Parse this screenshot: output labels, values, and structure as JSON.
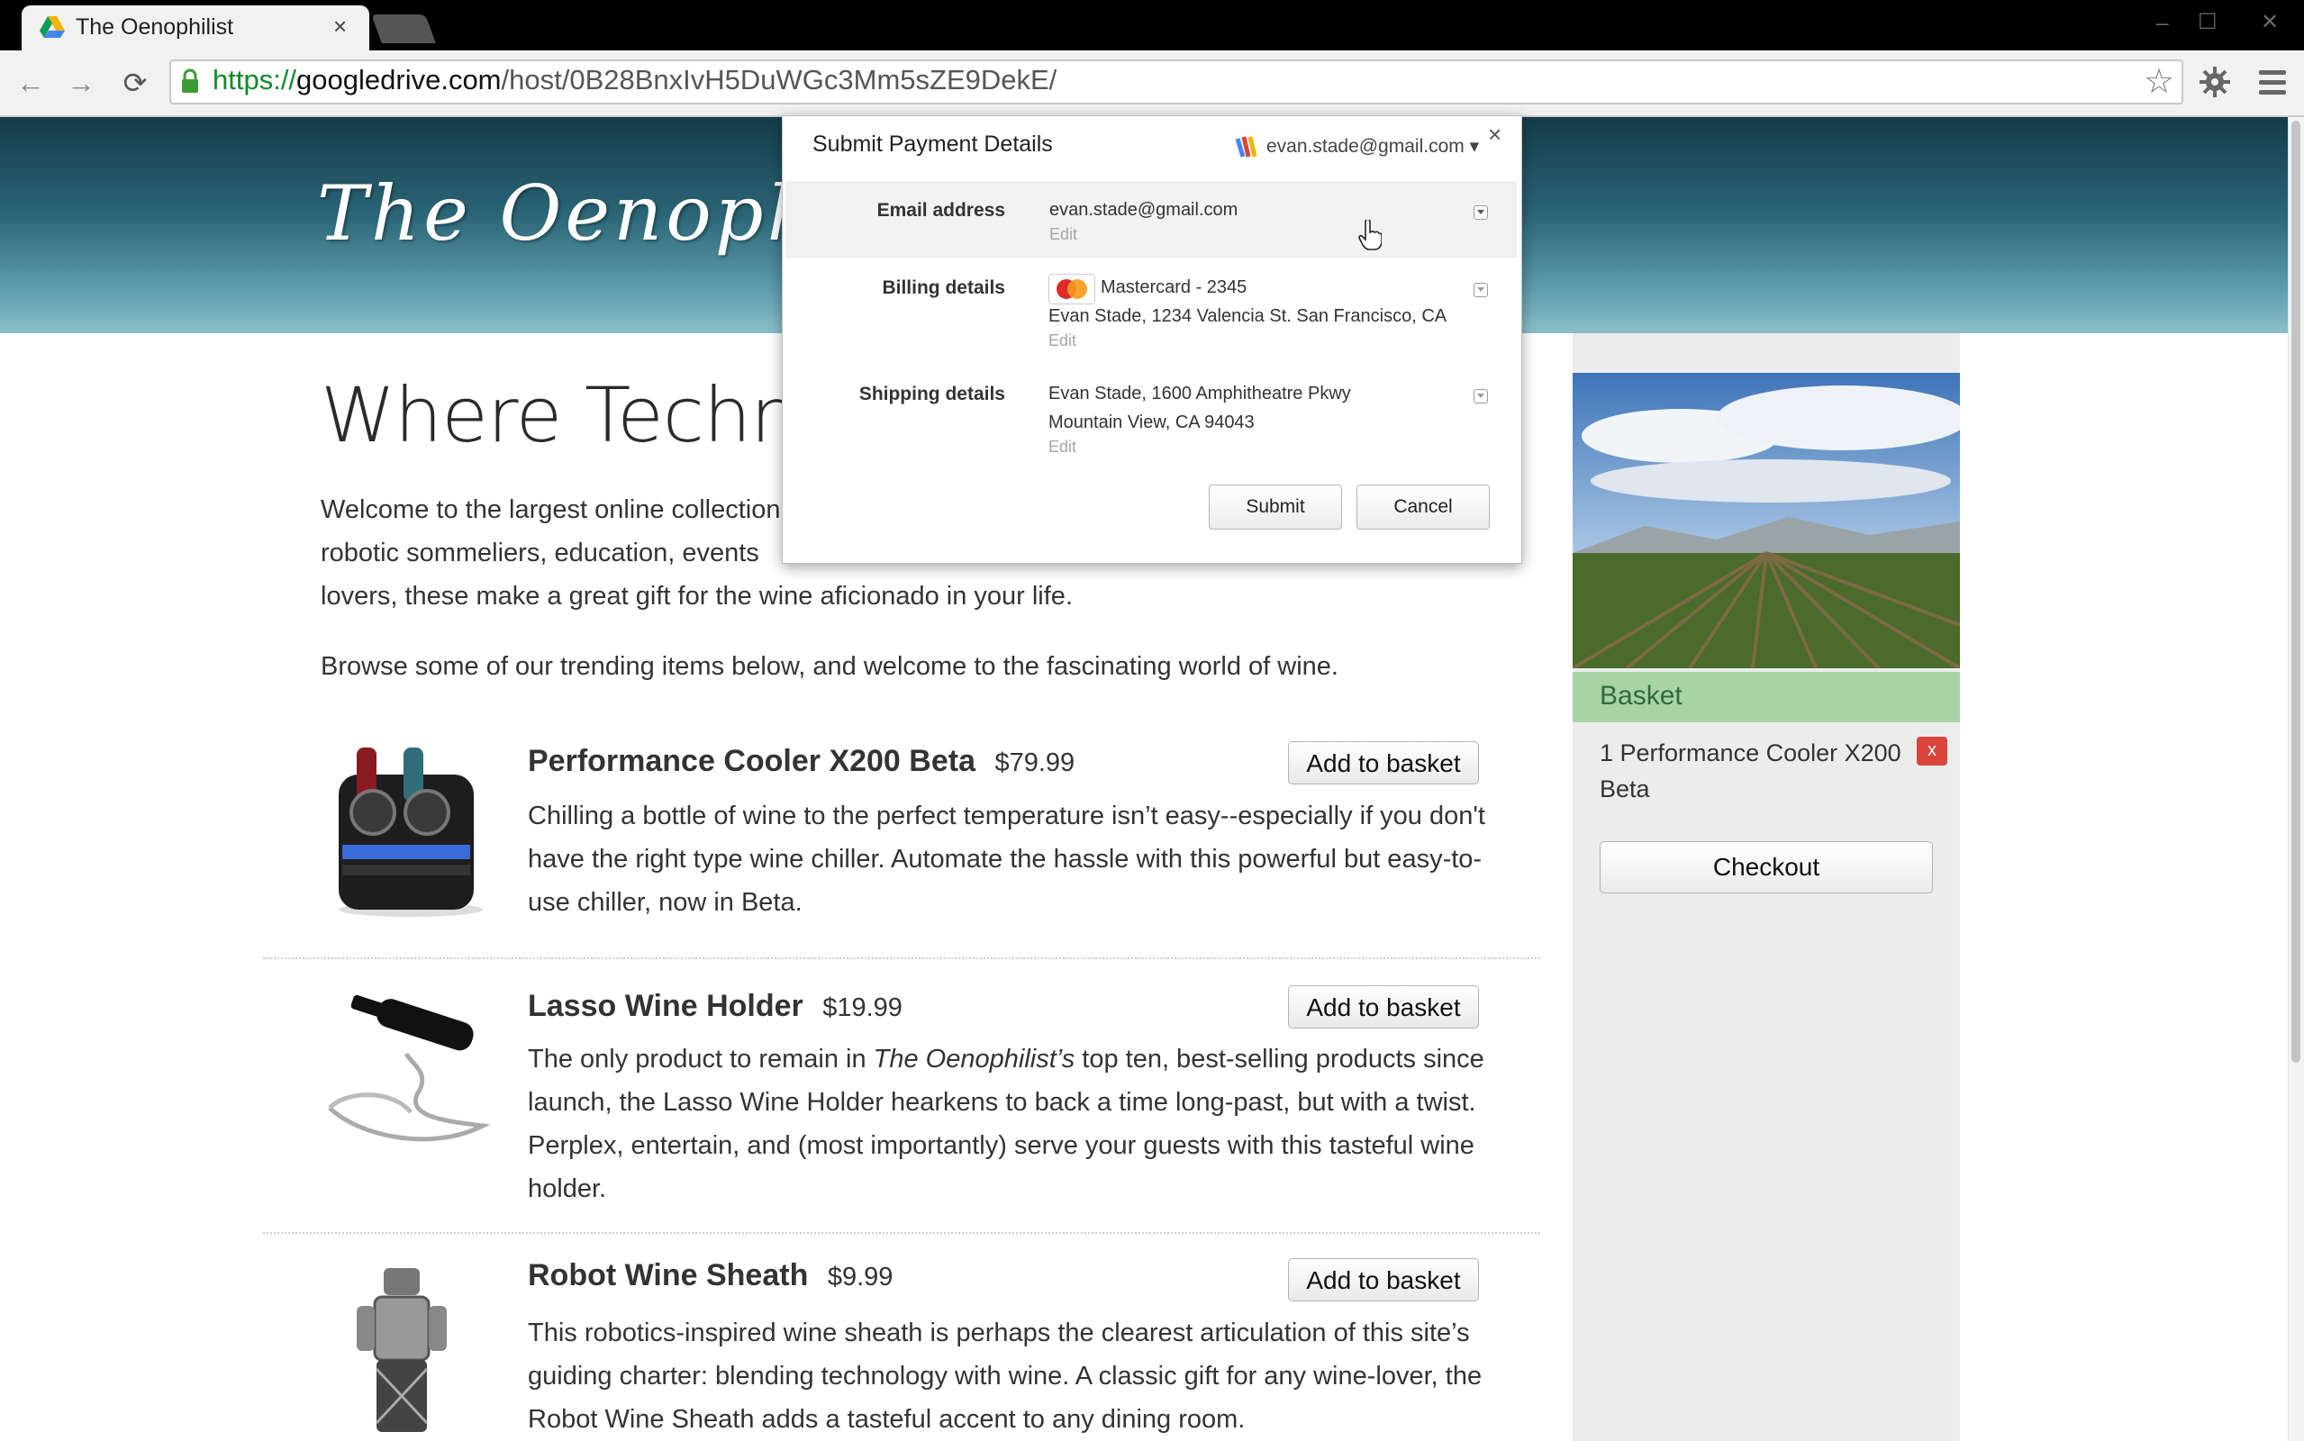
{
  "browser": {
    "tab_title": "The Oenophilist",
    "tab_close": "×",
    "url_scheme": "https://",
    "url_host": "googledrive.com",
    "url_path": "/host/0B28BnxIvH5DuWGc3Mm5sZE9DekE/",
    "window_min": "_",
    "window_max": "☐",
    "window_close": "✕",
    "back": "←",
    "forward": "→",
    "reload": "⟳",
    "star": "☆"
  },
  "site": {
    "logo_text": "The Oenophilist",
    "hero_title": "Where Technology",
    "intro_lines": [
      "Welcome to the largest online collection",
      "robotic sommeliers, education, events",
      "lovers, these make a great gift for the wine aficionado in your life."
    ],
    "browse_text": "Browse some of our trending items below, and welcome to the fascinating world of wine."
  },
  "products": [
    {
      "name": "Performance Cooler X200 Beta",
      "price": "$79.99",
      "button": "Add to basket",
      "desc_html": "Chilling a bottle of wine to the perfect temperature isn’t easy--especially if you don't have the right type wine chiller. Automate the hassle with this powerful but easy-to-use chiller, now in Beta."
    },
    {
      "name": "Lasso Wine Holder",
      "price": "$19.99",
      "button": "Add to basket",
      "desc_pre": "The only product to remain in ",
      "desc_em": "The Oenophilist’s",
      "desc_post": " top ten, best-selling products since launch, the Lasso Wine Holder hearkens to back a time long-past, but with a twist. Perplex, entertain, and (most importantly) serve your guests with this tasteful wine holder."
    },
    {
      "name": "Robot Wine Sheath",
      "price": "$9.99",
      "button": "Add to basket",
      "desc_html": "This robotics-inspired wine sheath is perhaps the clearest articulation of this site’s guiding charter: blending technology with wine. A classic gift for any wine-lover, the Robot Wine Sheath adds a tasteful accent to any dining room."
    }
  ],
  "basket": {
    "title": "Basket",
    "item": "1 Performance Cooler X200 Beta",
    "remove": "x",
    "checkout": "Checkout"
  },
  "dialog": {
    "title": "Submit Payment Details",
    "account": "evan.stade@gmail.com ▾",
    "close": "×",
    "email_label": "Email address",
    "email_value": "evan.stade@gmail.com",
    "billing_label": "Billing details",
    "billing_card": "Mastercard - 2345",
    "billing_address": "Evan Stade, 1234 Valencia St. San Francisco, CA",
    "shipping_label": "Shipping details",
    "shipping_line1": "Evan Stade, 1600 Amphitheatre Pkwy",
    "shipping_line2": "Mountain View, CA 94043",
    "edit": "Edit",
    "submit": "Submit",
    "cancel": "Cancel"
  },
  "colors": {
    "basket_header": "#a8d3a7",
    "remove_button": "#d9453a",
    "url_secure": "#0c8a28"
  }
}
